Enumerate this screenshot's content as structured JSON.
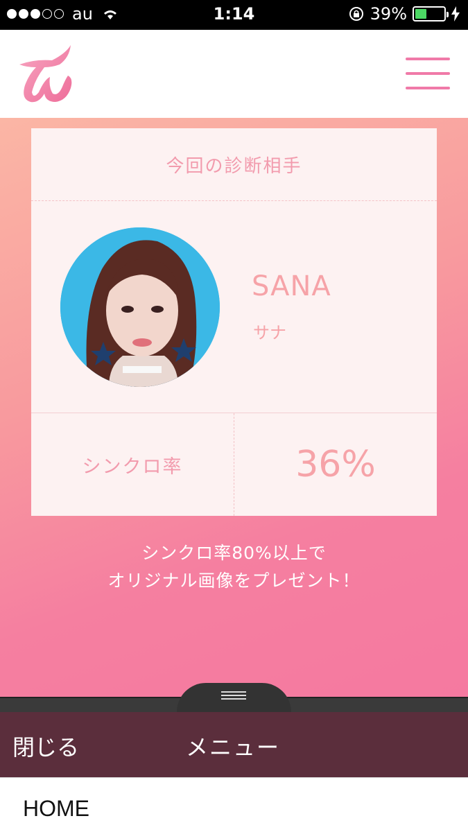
{
  "status_bar": {
    "carrier": "au",
    "time": "1:14",
    "battery_percent": "39%",
    "signal_bars": 3,
    "battery_level": 0.39
  },
  "header": {
    "logo_icon": "twice-logo",
    "menu_icon": "hamburger-menu-icon"
  },
  "card": {
    "heading": "今回の診断相手",
    "member_name_en": "SANA",
    "member_name_jp": "サナ",
    "sync_label": "シンクロ率",
    "sync_value": "36%"
  },
  "promo": {
    "line1": "シンクロ率80%以上で",
    "line2": "オリジナル画像をプレゼント！"
  },
  "drawer": {
    "close_label": "閉じる",
    "menu_title": "メニュー",
    "items": [
      {
        "label": "HOME"
      }
    ]
  },
  "colors": {
    "accent_pink": "#f07aa8",
    "drawer_bg": "#5b2e3c",
    "battery_green": "#4cd964"
  }
}
